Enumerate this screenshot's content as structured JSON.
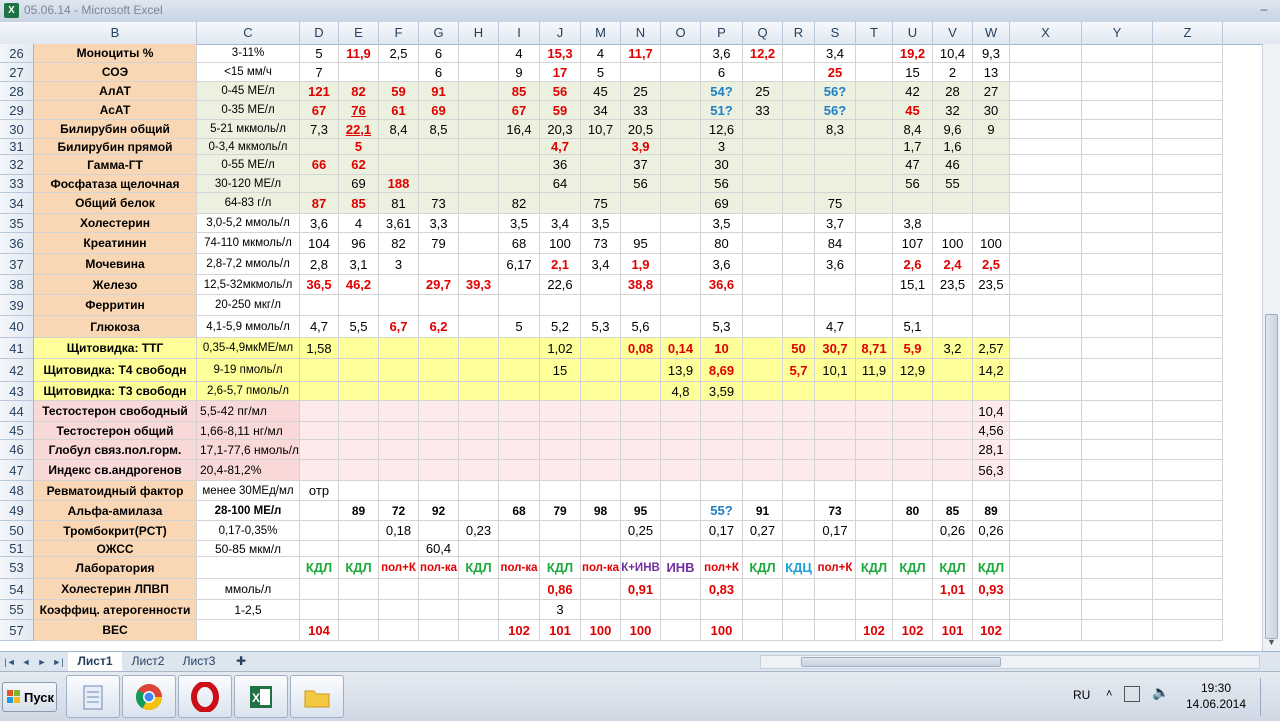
{
  "window": {
    "title": "05.06.14 - Microsoft Excel",
    "app_icon": "X",
    "minimize_glyph": "–"
  },
  "columns": [
    "B",
    "C",
    "D",
    "E",
    "F",
    "G",
    "H",
    "I",
    "J",
    "M",
    "N",
    "O",
    "P",
    "Q",
    "R",
    "S",
    "T",
    "U",
    "V",
    "W",
    "X",
    "Y",
    "Z"
  ],
  "rows": [
    {
      "num": "26",
      "label": "Моноциты %",
      "norm": "3-11%",
      "vals": {
        "D": "5",
        "E": "11,9",
        "F": "2,5",
        "G": "6",
        "I": "4",
        "J": "15,3",
        "M": "4",
        "N": "11,7",
        "P": "3,6",
        "Q": "12,2",
        "S": "3,4",
        "U": "19,2",
        "V": "10,4",
        "W": "9,3"
      },
      "red": [
        "E",
        "J",
        "N",
        "Q",
        "U"
      ]
    },
    {
      "num": "27",
      "label": "СОЭ",
      "norm": "<15 мм/ч",
      "vals": {
        "D": "7",
        "G": "6",
        "I": "9",
        "J": "17",
        "M": "5",
        "P": "6",
        "S": "25",
        "U": "15",
        "V": "2",
        "W": "13"
      },
      "red": [
        "J",
        "S"
      ]
    },
    {
      "num": "28",
      "label": "АлАТ",
      "norm": "0-45 МЕ/л",
      "vals": {
        "D": "121",
        "E": "82",
        "F": "59",
        "G": "91",
        "I": "85",
        "J": "56",
        "M": "45",
        "N": "25",
        "P": "54?",
        "Q": "25",
        "S": "56?",
        "U": "42",
        "V": "28",
        "W": "27"
      },
      "red": [
        "D",
        "E",
        "F",
        "G",
        "I",
        "J"
      ],
      "blue": [
        "P",
        "S"
      ]
    },
    {
      "num": "29",
      "label": "АсАТ",
      "norm": "0-35 МЕ/л",
      "vals": {
        "D": "67",
        "E": "76",
        "F": "61",
        "G": "69",
        "I": "67",
        "J": "59",
        "M": "34",
        "N": "33",
        "P": "51?",
        "Q": "33",
        "S": "56?",
        "U": "45",
        "V": "32",
        "W": "30"
      },
      "red": [
        "D",
        "E",
        "F",
        "G",
        "I",
        "J",
        "U"
      ],
      "blue": [
        "P",
        "S"
      ]
    },
    {
      "num": "30",
      "label": "Билирубин общий",
      "norm": "5-21 мкмоль/л",
      "vals": {
        "D": "7,3",
        "E": "22,1",
        "F": "8,4",
        "G": "8,5",
        "I": "16,4",
        "J": "20,3",
        "M": "10,7",
        "N": "20,5",
        "P": "12,6",
        "S": "8,3",
        "U": "8,4",
        "V": "9,6",
        "W": "9"
      },
      "red": [
        "E"
      ]
    },
    {
      "num": "31",
      "label": "Билирубин прямой",
      "norm": "0-3,4 мкмоль/л",
      "vals": {
        "E": "5",
        "J": "4,7",
        "N": "3,9",
        "P": "3",
        "U": "1,7",
        "V": "1,6"
      },
      "red": [
        "E",
        "J",
        "N"
      ]
    },
    {
      "num": "32",
      "label": "Гамма-ГТ",
      "norm": "0-55 МЕ/л",
      "vals": {
        "D": "66",
        "E": "62",
        "J": "36",
        "N": "37",
        "P": "30",
        "U": "47",
        "V": "46"
      },
      "red": [
        "D",
        "E"
      ]
    },
    {
      "num": "33",
      "label": "Фосфатаза щелочная",
      "norm": "30-120 МЕ/л",
      "vals": {
        "E": "69",
        "F": "188",
        "J": "64",
        "N": "56",
        "P": "56",
        "U": "56",
        "V": "55"
      },
      "red": [
        "F"
      ]
    },
    {
      "num": "34",
      "label": "Общий белок",
      "norm": "64-83 г/л",
      "vals": {
        "D": "87",
        "E": "85",
        "F": "81",
        "G": "73",
        "I": "82",
        "M": "75",
        "P": "69",
        "S": "75"
      },
      "red": [
        "D",
        "E"
      ]
    },
    {
      "num": "35",
      "label": "Холестерин",
      "norm": "3,0-5,2 ммоль/л",
      "vals": {
        "D": "3,6",
        "E": "4",
        "F": "3,61",
        "G": "3,3",
        "I": "3,5",
        "J": "3,4",
        "M": "3,5",
        "P": "3,5",
        "S": "3,7",
        "U": "3,8"
      }
    },
    {
      "num": "36",
      "label": "Креатинин",
      "norm": "74-110 мкмоль/л",
      "vals": {
        "D": "104",
        "E": "96",
        "F": "82",
        "G": "79",
        "I": "68",
        "J": "100",
        "M": "73",
        "N": "95",
        "P": "80",
        "S": "84",
        "U": "107",
        "V": "100",
        "W": "100"
      }
    },
    {
      "num": "37",
      "label": "Мочевина",
      "norm": "2,8-7,2 ммоль/л",
      "vals": {
        "D": "2,8",
        "E": "3,1",
        "F": "3",
        "I": "6,17",
        "J": "2,1",
        "M": "3,4",
        "N": "1,9",
        "P": "3,6",
        "S": "3,6",
        "U": "2,6",
        "V": "2,4",
        "W": "2,5"
      },
      "red": [
        "J",
        "N",
        "U",
        "V",
        "W"
      ]
    },
    {
      "num": "38",
      "label": "Железо",
      "norm": "12,5-32мкмоль/л",
      "vals": {
        "D": "36,5",
        "E": "46,2",
        "G": "29,7",
        "H": "39,3",
        "J": "22,6",
        "N": "38,8",
        "P": "36,6",
        "U": "15,1",
        "V": "23,5",
        "W": "23,5"
      },
      "red": [
        "D",
        "E",
        "G",
        "H",
        "N",
        "P"
      ]
    },
    {
      "num": "39",
      "label": "Ферритин",
      "norm": "20-250 мкг/л",
      "vals": {}
    },
    {
      "num": "40",
      "label": "Глюкоза",
      "norm": "4,1-5,9 ммоль/л",
      "vals": {
        "D": "4,7",
        "E": "5,5",
        "F": "6,7",
        "G": "6,2",
        "I": "5",
        "J": "5,2",
        "M": "5,3",
        "N": "5,6",
        "P": "5,3",
        "S": "4,7",
        "U": "5,1"
      },
      "red": [
        "F",
        "G"
      ]
    },
    {
      "num": "41",
      "label": "Щитовидка: ТТГ",
      "norm": "0,35-4,9мкМЕ/мл",
      "vals": {
        "D": "1,58",
        "J": "1,02",
        "N": "0,08",
        "O": "0,14",
        "P": "10",
        "R": "50",
        "S": "30,7",
        "T": "8,71",
        "U": "5,9",
        "V": "3,2",
        "W": "2,57"
      },
      "red": [
        "N",
        "O",
        "P",
        "R",
        "S",
        "T",
        "U"
      ]
    },
    {
      "num": "42",
      "label": "Щитовидка: Т4 свободн",
      "norm": "9-19 пмоль/л",
      "vals": {
        "J": "15",
        "O": "13,9",
        "P": "8,69",
        "R": "5,7",
        "S": "10,1",
        "T": "11,9",
        "U": "12,9",
        "W": "14,2"
      },
      "red": [
        "P",
        "R"
      ]
    },
    {
      "num": "43",
      "label": "Щитовидка: Т3 свободн",
      "norm": "2,6-5,7 пмоль/л",
      "vals": {
        "O": "4,8",
        "P": "3,59"
      }
    },
    {
      "num": "44",
      "label": "Тестостерон свободный",
      "norm": "5,5-42 пг/мл",
      "vals": {
        "W": "10,4"
      }
    },
    {
      "num": "45",
      "label": "Тестостерон общий",
      "norm": "1,66-8,11 нг/мл",
      "vals": {
        "W": "4,56"
      }
    },
    {
      "num": "46",
      "label": "Глобул связ.пол.горм.",
      "norm": "17,1-77,6 нмоль/л",
      "vals": {
        "W": "28,1"
      }
    },
    {
      "num": "47",
      "label": "Индекс св.андрогенов",
      "norm": "20,4-81,2%",
      "vals": {
        "W": "56,3"
      }
    },
    {
      "num": "48",
      "label": "Ревматоидный фактор",
      "norm": "менее 30МЕд/мл",
      "vals": {
        "D": "отр"
      }
    },
    {
      "num": "49",
      "label": "Альфа-амилаза",
      "norm": "28-100 МЕ/л",
      "vals": {
        "E": "89",
        "F": "72",
        "G": "92",
        "I": "68",
        "J": "79",
        "M": "98",
        "N": "95",
        "P": "55?",
        "Q": "91",
        "S": "73",
        "U": "80",
        "V": "85",
        "W": "89"
      },
      "blue": [
        "P"
      ]
    },
    {
      "num": "50",
      "label": "Тромбокрит(PCT)",
      "norm": "0,17-0,35%",
      "vals": {
        "F": "0,18",
        "H": "0,23",
        "N": "0,25",
        "P": "0,17",
        "Q": "0,27",
        "S": "0,17",
        "V": "0,26",
        "W": "0,26"
      }
    },
    {
      "num": "51",
      "label": "ОЖСС",
      "norm": "50-85 мкм/л",
      "vals": {
        "G": "60,4"
      }
    },
    {
      "num": "53",
      "label": "Лаборатория",
      "norm": "",
      "vals": {
        "D": "КДЛ",
        "E": "КДЛ",
        "F": "пол+К",
        "G": "пол-ка",
        "H": "КДЛ",
        "I": "пол-ка",
        "J": "КДЛ",
        "M": "пол-ка",
        "N": "К+ИНВ",
        "O": "ИНВ",
        "P": "пол+К",
        "Q": "КДЛ",
        "R": "КДЦ",
        "S": "пол+К",
        "T": "КДЛ",
        "U": "КДЛ",
        "V": "КДЛ",
        "W": "КДЛ"
      }
    },
    {
      "num": "54",
      "label": "Холестерин ЛПВП",
      "norm": "ммоль/л",
      "vals": {
        "J": "0,86",
        "N": "0,91",
        "P": "0,83",
        "V": "1,01",
        "W": "0,93"
      },
      "red": [
        "J",
        "N",
        "P",
        "V",
        "W"
      ]
    },
    {
      "num": "55",
      "label": "Коэффиц. атерогенности",
      "norm": "1-2,5",
      "vals": {
        "J": "3"
      }
    },
    {
      "num": "57",
      "label": "ВЕС",
      "norm": "",
      "vals": {
        "D": "104",
        "I": "102",
        "J": "101",
        "M": "100",
        "N": "100",
        "P": "100",
        "T": "102",
        "U": "102",
        "V": "101",
        "W": "102"
      },
      "red": [
        "D",
        "I",
        "J",
        "M",
        "N",
        "P",
        "T",
        "U",
        "V",
        "W"
      ]
    }
  ],
  "sheets": [
    "Лист1",
    "Лист2",
    "Лист3"
  ],
  "taskbar": {
    "start_label": "Пуск",
    "lang": "RU",
    "time": "19:30",
    "date": "14.06.2014"
  },
  "colors": {
    "red": "#e00000",
    "blue": "#1e7fc8",
    "green": "#1faa3c",
    "header": "#27415f"
  }
}
